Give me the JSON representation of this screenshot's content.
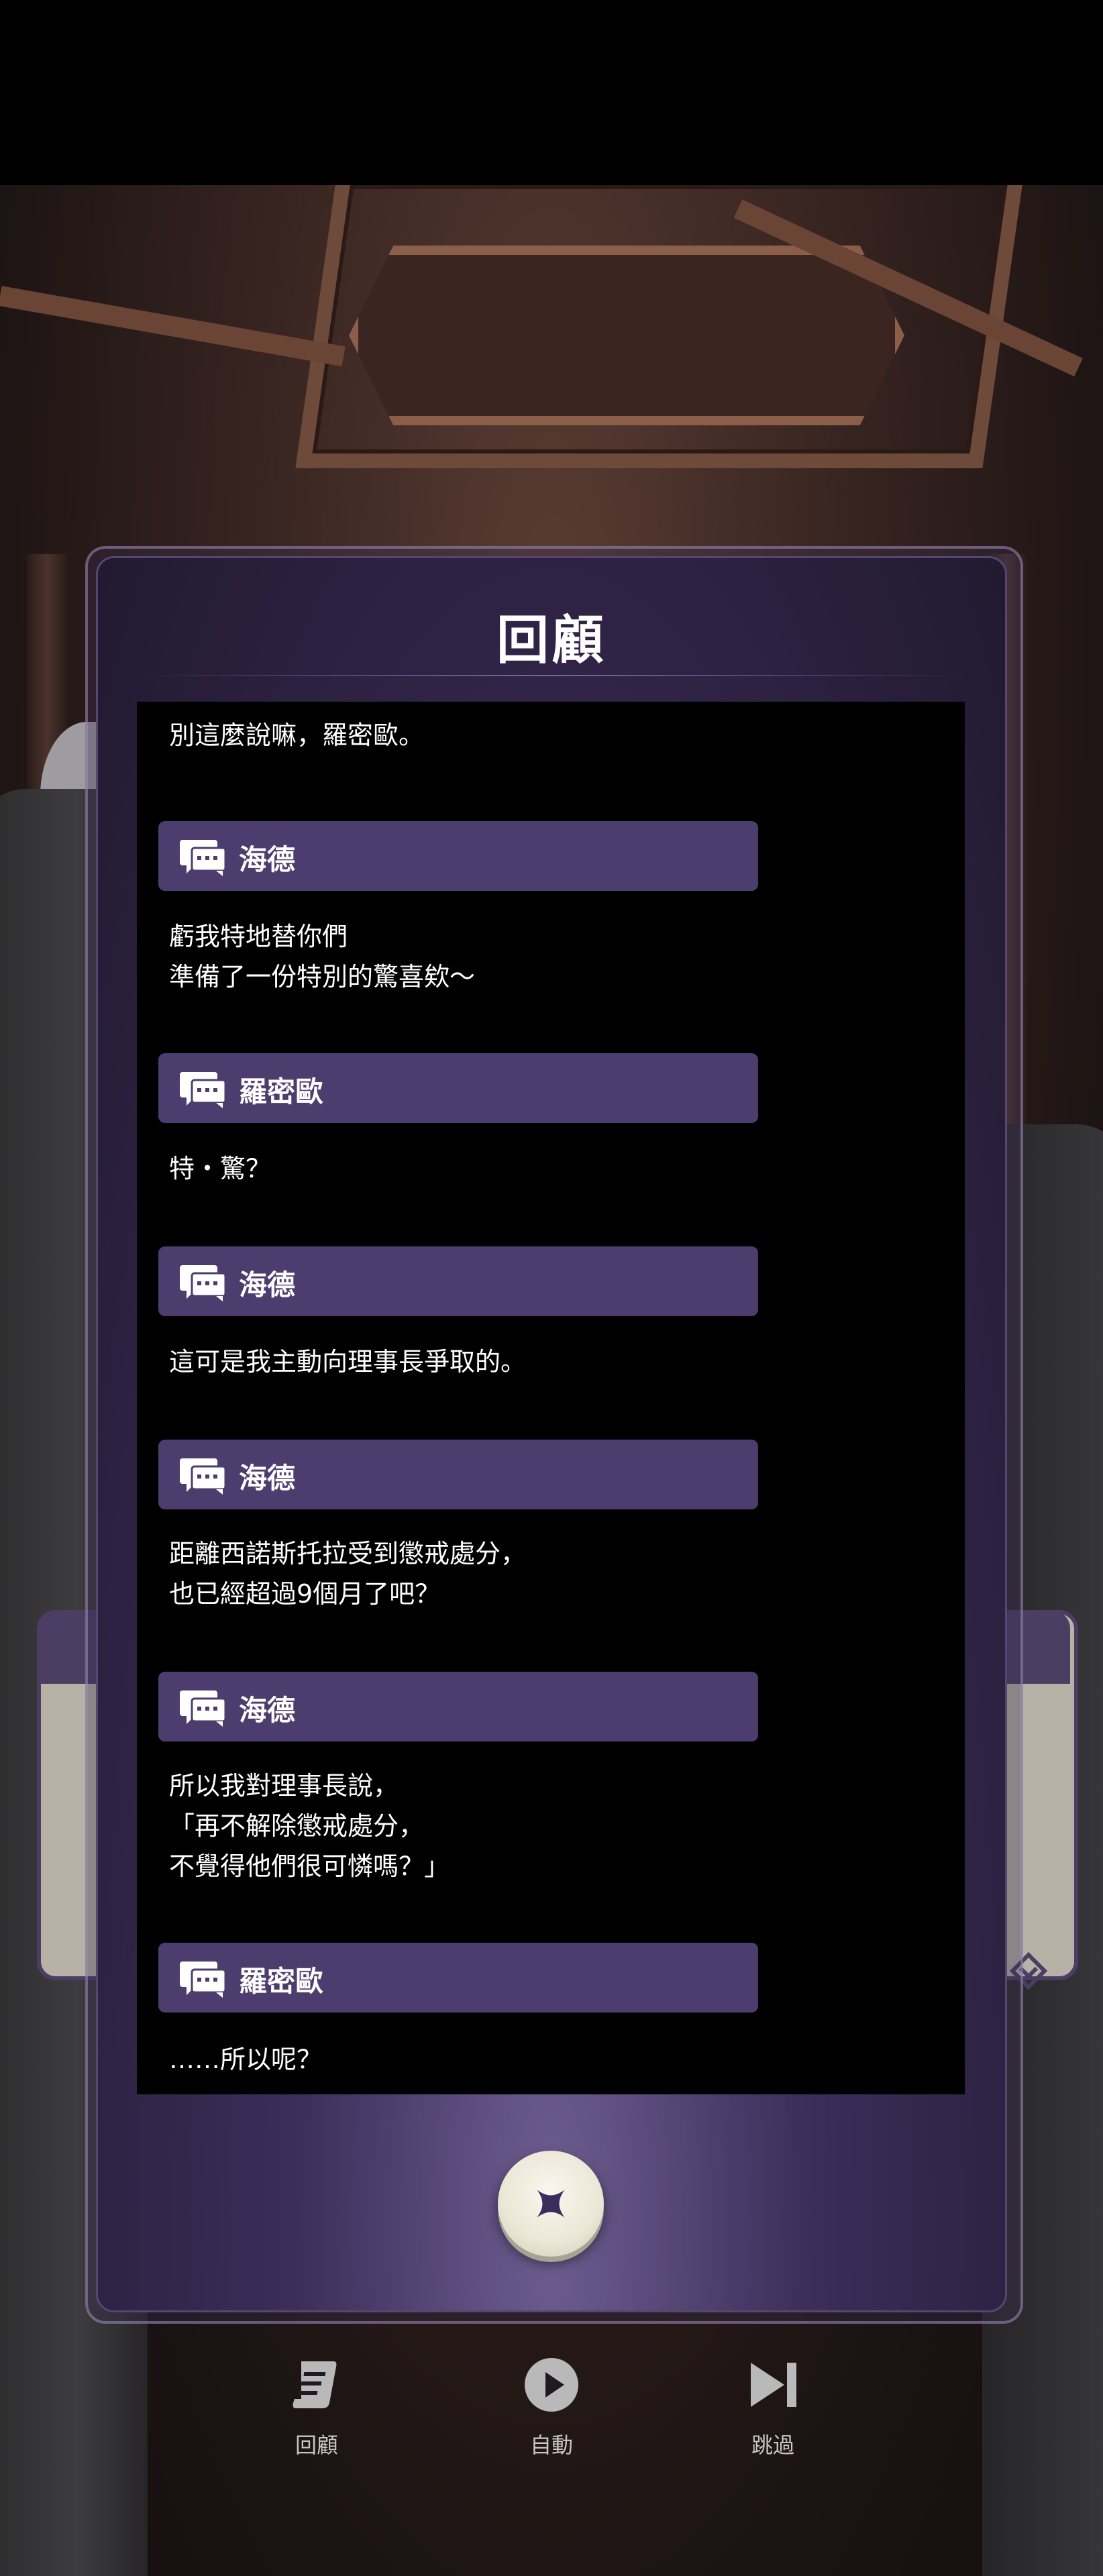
{
  "review_panel": {
    "title": "回顧",
    "entries": [
      {
        "speaker": "",
        "text": "別這麼說嘛，羅密歐。"
      },
      {
        "speaker": "海德",
        "text": "虧我特地替你們\n準備了一份特別的驚喜欸～"
      },
      {
        "speaker": "羅密歐",
        "text": "特・驚？"
      },
      {
        "speaker": "海德",
        "text": "這可是我主動向理事長爭取的。"
      },
      {
        "speaker": "海德",
        "text": "距離西諾斯托拉受到懲戒處分，\n也已經超過9個月了吧？"
      },
      {
        "speaker": "海德",
        "text": "所以我對理事長說，\n「再不解除懲戒處分，\n不覺得他們很可憐嗎？」"
      },
      {
        "speaker": "羅密歐",
        "text": "……所以呢？"
      }
    ],
    "close_icon": "close-x-icon"
  },
  "bottom_bar": {
    "items": [
      {
        "label": "回顧",
        "icon": "scroll-icon"
      },
      {
        "label": "自動",
        "icon": "play-icon"
      },
      {
        "label": "跳過",
        "icon": "skip-icon"
      }
    ]
  },
  "colors": {
    "panel_bg": "#2c2140",
    "name_bar": "#4d3d6e",
    "log_bg": "#000000",
    "close_button": "#ece6d6",
    "close_x": "#3b2c5e"
  }
}
